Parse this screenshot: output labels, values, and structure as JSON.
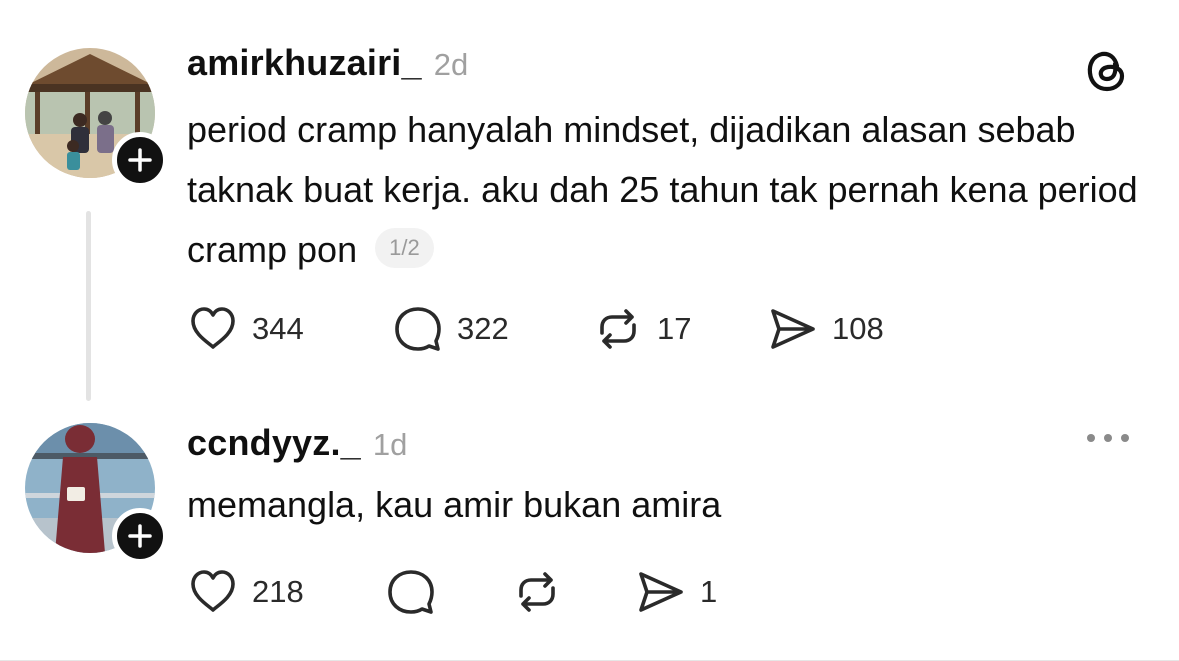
{
  "posts": [
    {
      "username": "amirkhuzairi_",
      "time": "2d",
      "text": "period cramp hanyalah mindset, dijadikan alasan sebab taknak buat kerja. aku dah 25 tahun tak pernah kena period cramp pon",
      "page_indicator": "1/2",
      "likes": "344",
      "replies": "322",
      "reposts": "17",
      "shares": "108"
    },
    {
      "username": "ccndyyz._",
      "time": "1d",
      "text": "memangla, kau amir bukan amira",
      "likes": "218",
      "shares": "1"
    }
  ],
  "icons": {
    "header": "threads-logo-icon",
    "more": "more-options-icon",
    "follow": "plus-icon",
    "like": "heart-icon",
    "reply": "comment-icon",
    "repost": "repost-icon",
    "share": "send-icon"
  },
  "colors": {
    "text": "#101010",
    "muted": "#a0a0a0",
    "badge_bg": "#f2f2f2"
  }
}
